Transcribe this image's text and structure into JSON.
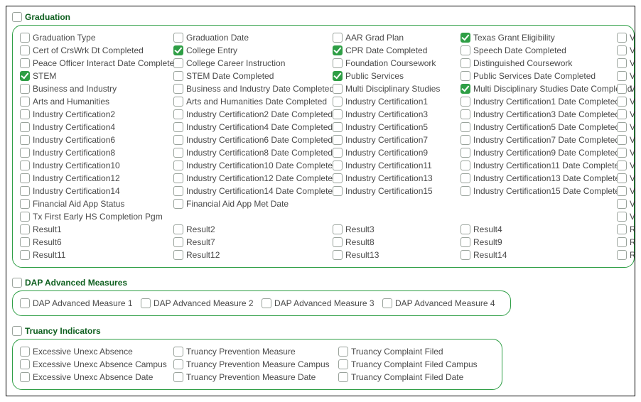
{
  "sections": {
    "graduation": {
      "title": "Graduation"
    },
    "dap": {
      "title": "DAP Advanced Measures"
    },
    "truancy": {
      "title": "Truancy Indicators"
    }
  },
  "grad_rows": [
    [
      {
        "k": "grad_type",
        "label": "Graduation Type",
        "chk": false
      },
      {
        "k": "grad_date",
        "label": "Graduation Date",
        "chk": false
      },
      {
        "k": "aar",
        "label": "AAR Grad Plan",
        "chk": false
      },
      {
        "k": "tx_grant",
        "label": "Texas Grant Eligibility",
        "chk": true
      },
      {
        "k": "v1",
        "label": "Venc",
        "chk": false
      }
    ],
    [
      {
        "k": "crswrk",
        "label": "Cert of CrsWrk Dt Completed",
        "chk": false
      },
      {
        "k": "college_entry",
        "label": "College Entry",
        "chk": true
      },
      {
        "k": "cpr",
        "label": "CPR Date Completed",
        "chk": true
      },
      {
        "k": "speech",
        "label": "Speech Date Completed",
        "chk": false
      },
      {
        "k": "v2",
        "label": "Venc",
        "chk": false
      }
    ],
    [
      {
        "k": "peace",
        "label": "Peace Officer Interact Date Completed",
        "chk": false
      },
      {
        "k": "cci",
        "label": "College Career Instruction",
        "chk": false
      },
      {
        "k": "found",
        "label": "Foundation Coursework",
        "chk": false
      },
      {
        "k": "dist",
        "label": "Distinguished Coursework",
        "chk": false
      },
      {
        "k": "v3",
        "label": "Venc",
        "chk": false
      }
    ],
    [
      {
        "k": "stem",
        "label": "STEM",
        "chk": true
      },
      {
        "k": "stemdc",
        "label": "STEM Date Completed",
        "chk": false
      },
      {
        "k": "pubserv",
        "label": "Public Services",
        "chk": true
      },
      {
        "k": "pubservdc",
        "label": "Public Services Date Completed",
        "chk": false
      },
      {
        "k": "v4",
        "label": "Venc",
        "chk": false
      }
    ],
    [
      {
        "k": "bi",
        "label": "Business and Industry",
        "chk": false
      },
      {
        "k": "bidc",
        "label": "Business and Industry Date Completed",
        "chk": false
      },
      {
        "k": "mds",
        "label": "Multi Disciplinary Studies",
        "chk": false
      },
      {
        "k": "mdsdc",
        "label": "Multi Disciplinary Studies Date Completed",
        "chk": true
      },
      {
        "k": "v5",
        "label": "Venc",
        "chk": false
      }
    ],
    [
      {
        "k": "ah",
        "label": "Arts and Humanities",
        "chk": false
      },
      {
        "k": "ahdc",
        "label": "Arts and Humanities Date Completed",
        "chk": false
      },
      {
        "k": "ic1",
        "label": "Industry Certification1",
        "chk": false
      },
      {
        "k": "ic1dc",
        "label": "Industry Certification1 Date Completed",
        "chk": false
      },
      {
        "k": "v6",
        "label": "Venc",
        "chk": false
      }
    ],
    [
      {
        "k": "ic2",
        "label": "Industry Certification2",
        "chk": false
      },
      {
        "k": "ic2dc",
        "label": "Industry Certification2 Date Completed",
        "chk": false
      },
      {
        "k": "ic3",
        "label": "Industry Certification3",
        "chk": false
      },
      {
        "k": "ic3dc",
        "label": "Industry Certification3 Date Completed",
        "chk": false
      },
      {
        "k": "v7",
        "label": "Venc",
        "chk": false
      }
    ],
    [
      {
        "k": "ic4",
        "label": "Industry Certification4",
        "chk": false
      },
      {
        "k": "ic4dc",
        "label": "Industry Certification4 Date Completed",
        "chk": false
      },
      {
        "k": "ic5",
        "label": "Industry Certification5",
        "chk": false
      },
      {
        "k": "ic5dc",
        "label": "Industry Certification5 Date Completed",
        "chk": false
      },
      {
        "k": "v8",
        "label": "Venc",
        "chk": false
      }
    ],
    [
      {
        "k": "ic6",
        "label": "Industry Certification6",
        "chk": false
      },
      {
        "k": "ic6dc",
        "label": "Industry Certification6 Date Completed",
        "chk": false
      },
      {
        "k": "ic7",
        "label": "Industry Certification7",
        "chk": false
      },
      {
        "k": "ic7dc",
        "label": "Industry Certification7 Date Completed",
        "chk": false
      },
      {
        "k": "v9",
        "label": "Venc",
        "chk": false
      }
    ],
    [
      {
        "k": "ic8",
        "label": "Industry Certification8",
        "chk": false
      },
      {
        "k": "ic8dc",
        "label": "Industry Certification8 Date Completed",
        "chk": false
      },
      {
        "k": "ic9",
        "label": "Industry Certification9",
        "chk": false
      },
      {
        "k": "ic9dc",
        "label": "Industry Certification9 Date Completed",
        "chk": false
      },
      {
        "k": "v10",
        "label": "Venc",
        "chk": false
      }
    ],
    [
      {
        "k": "ic10",
        "label": "Industry Certification10",
        "chk": false
      },
      {
        "k": "ic10dc",
        "label": "Industry Certification10 Date Completed",
        "chk": false
      },
      {
        "k": "ic11",
        "label": "Industry Certification11",
        "chk": false
      },
      {
        "k": "ic11dc",
        "label": "Industry Certification11 Date Completed",
        "chk": false
      },
      {
        "k": "v11",
        "label": "Venc",
        "chk": false
      }
    ],
    [
      {
        "k": "ic12",
        "label": "Industry Certification12",
        "chk": false
      },
      {
        "k": "ic12dc",
        "label": "Industry Certification12 Date Completed",
        "chk": false
      },
      {
        "k": "ic13",
        "label": "Industry Certification13",
        "chk": false
      },
      {
        "k": "ic13dc",
        "label": "Industry Certification13 Date Completed",
        "chk": false
      },
      {
        "k": "v12",
        "label": "Venc",
        "chk": false
      }
    ],
    [
      {
        "k": "ic14",
        "label": "Industry Certification14",
        "chk": false
      },
      {
        "k": "ic14dc",
        "label": "Industry Certification14 Date Completed",
        "chk": false
      },
      {
        "k": "ic15",
        "label": "Industry Certification15",
        "chk": false
      },
      {
        "k": "ic15dc",
        "label": "Industry Certification15 Date Completed",
        "chk": false
      },
      {
        "k": "v13",
        "label": "Venc",
        "chk": false
      }
    ],
    [
      {
        "k": "faa",
        "label": "Financial Aid App Status",
        "chk": false
      },
      {
        "k": "faam",
        "label": "Financial Aid App Met Date",
        "chk": false
      },
      null,
      null,
      {
        "k": "v14",
        "label": "Venc",
        "chk": false
      }
    ],
    [
      {
        "k": "txfe",
        "label": "Tx First Early HS Completion Pgm",
        "chk": false
      },
      null,
      null,
      null,
      {
        "k": "v15",
        "label": "Venc",
        "chk": false
      }
    ],
    [
      {
        "k": "r1",
        "label": "Result1",
        "chk": false
      },
      {
        "k": "r2",
        "label": "Result2",
        "chk": false
      },
      {
        "k": "r3",
        "label": "Result3",
        "chk": false
      },
      {
        "k": "r4",
        "label": "Result4",
        "chk": false
      },
      {
        "k": "r5",
        "label": "Resu",
        "chk": false
      }
    ],
    [
      {
        "k": "r6",
        "label": "Result6",
        "chk": false
      },
      {
        "k": "r7",
        "label": "Result7",
        "chk": false
      },
      {
        "k": "r8",
        "label": "Result8",
        "chk": false
      },
      {
        "k": "r9",
        "label": "Result9",
        "chk": false
      },
      {
        "k": "r10",
        "label": "Resu",
        "chk": false
      }
    ],
    [
      {
        "k": "r11",
        "label": "Result11",
        "chk": false
      },
      {
        "k": "r12",
        "label": "Result12",
        "chk": false
      },
      {
        "k": "r13",
        "label": "Result13",
        "chk": false
      },
      {
        "k": "r14",
        "label": "Result14",
        "chk": false
      },
      {
        "k": "r15",
        "label": "Resu",
        "chk": false
      }
    ]
  ],
  "dap_items": [
    {
      "k": "dap1",
      "label": "DAP Advanced Measure 1"
    },
    {
      "k": "dap2",
      "label": "DAP Advanced Measure 2"
    },
    {
      "k": "dap3",
      "label": "DAP Advanced Measure 3"
    },
    {
      "k": "dap4",
      "label": "DAP Advanced Measure 4"
    }
  ],
  "tru_rows": [
    [
      {
        "k": "eua",
        "label": "Excessive Unexc Absence"
      },
      {
        "k": "tpm",
        "label": "Truancy Prevention Measure"
      },
      {
        "k": "tcf",
        "label": "Truancy Complaint Filed"
      }
    ],
    [
      {
        "k": "euac",
        "label": "Excessive Unexc Absence Campus"
      },
      {
        "k": "tpmc",
        "label": "Truancy Prevention Measure Campus"
      },
      {
        "k": "tcfc",
        "label": "Truancy Complaint Filed Campus"
      }
    ],
    [
      {
        "k": "euad",
        "label": "Excessive Unexc Absence Date"
      },
      {
        "k": "tpmd",
        "label": "Truancy Prevention Measure Date"
      },
      {
        "k": "tcfd",
        "label": "Truancy Complaint Filed Date"
      }
    ]
  ]
}
